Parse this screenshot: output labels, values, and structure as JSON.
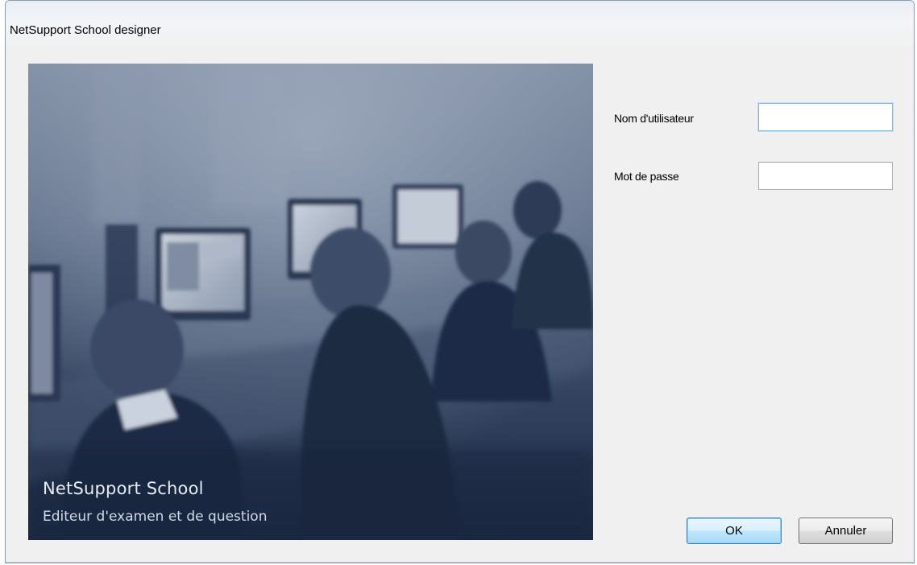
{
  "window": {
    "title": "NetSupport School designer"
  },
  "banner": {
    "title": "NetSupport School",
    "subtitle": "Editeur d'examen et de question"
  },
  "form": {
    "username_label": "Nom d'utilisateur",
    "username_value": "",
    "password_label": "Mot de passe",
    "password_value": ""
  },
  "buttons": {
    "ok_label": "OK",
    "cancel_label": "Annuler"
  }
}
